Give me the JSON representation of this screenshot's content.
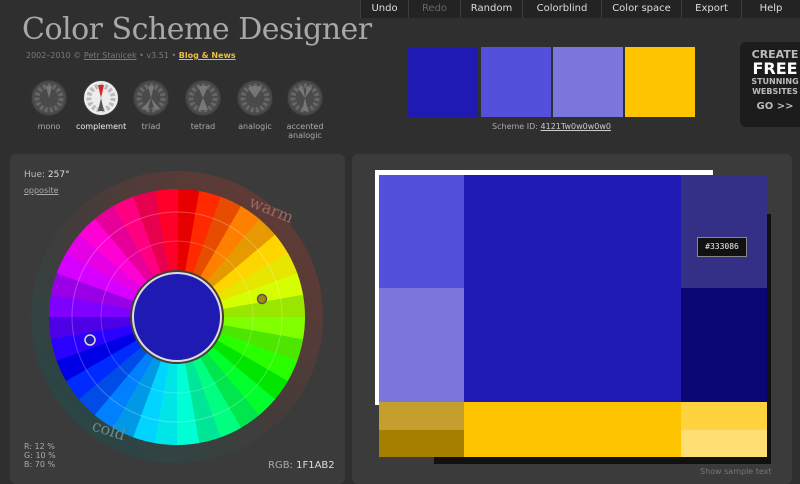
{
  "header": {
    "title": "Color Scheme Designer",
    "credits": {
      "prefix": "2002–2010 © ",
      "author": "Petr Stanicek",
      "version": " • v3.51 • ",
      "blog": "Blog & News"
    }
  },
  "menu": {
    "items": [
      {
        "label": "Undo",
        "enabled": true
      },
      {
        "label": "Redo",
        "enabled": false
      },
      {
        "label": "Random",
        "enabled": true
      },
      {
        "label": "Colorblind",
        "enabled": true
      },
      {
        "label": "Color space",
        "enabled": true
      },
      {
        "label": "Export",
        "enabled": true
      },
      {
        "label": "Help",
        "enabled": true
      }
    ]
  },
  "modes": {
    "items": [
      {
        "label": "mono",
        "active": false
      },
      {
        "label": "complement",
        "active": true
      },
      {
        "label": "triad",
        "active": false
      },
      {
        "label": "tetrad",
        "active": false
      },
      {
        "label": "analogic",
        "active": false
      },
      {
        "label": "accented analogic",
        "active": false
      }
    ]
  },
  "swatches": [
    "#1f1ab2",
    "#5550dc",
    "#7a76dc",
    "#ffc400"
  ],
  "scheme": {
    "label": "Scheme ID: ",
    "id": "4121Tw0w0w0w0"
  },
  "promo": {
    "l1": "CREATE",
    "l2": "FREE",
    "l3a": "STUNNING",
    "l3b": "WEBSITES",
    "l4": "GO >>"
  },
  "wheel": {
    "hue_label": "Hue: ",
    "hue_value": "257°",
    "opposite": "opposite",
    "warm": "warm",
    "cold": "cold",
    "center_color": "#1f1ab2",
    "r": "R: 12 %",
    "g": "G: 10 %",
    "b": "B: 70 %",
    "rgb_label": "RGB: ",
    "rgb_value": "1F1AB2"
  },
  "preview": {
    "colors": {
      "primary": "#1f1ab2",
      "primary_light": "#5550dc",
      "primary_lighter": "#7a76dc",
      "primary_dark": "#333086",
      "primary_darker": "#0a0774",
      "complement": "#ffc400",
      "complement_dark": "#c49f2e",
      "complement_darker": "#a67f00",
      "complement_light": "#ffd340",
      "complement_lighter": "#ffde73"
    },
    "tooltip": "#333086",
    "show_sample": "Show sample text"
  }
}
